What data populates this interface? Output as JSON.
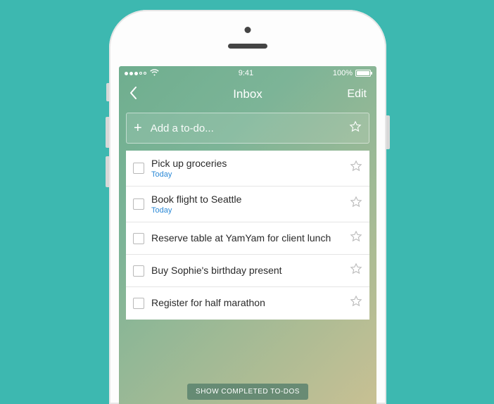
{
  "status_bar": {
    "time": "9:41",
    "battery_pct": "100%"
  },
  "nav": {
    "title": "Inbox",
    "edit_label": "Edit"
  },
  "add_row": {
    "placeholder": "Add a to-do..."
  },
  "todos": [
    {
      "title": "Pick up groceries",
      "due": "Today"
    },
    {
      "title": "Book flight to Seattle",
      "due": "Today"
    },
    {
      "title": "Reserve table at YamYam for client lunch",
      "due": ""
    },
    {
      "title": "Buy Sophie's birthday present",
      "due": ""
    },
    {
      "title": "Register for half marathon",
      "due": ""
    }
  ],
  "completed_button": "SHOW COMPLETED TO-DOS"
}
